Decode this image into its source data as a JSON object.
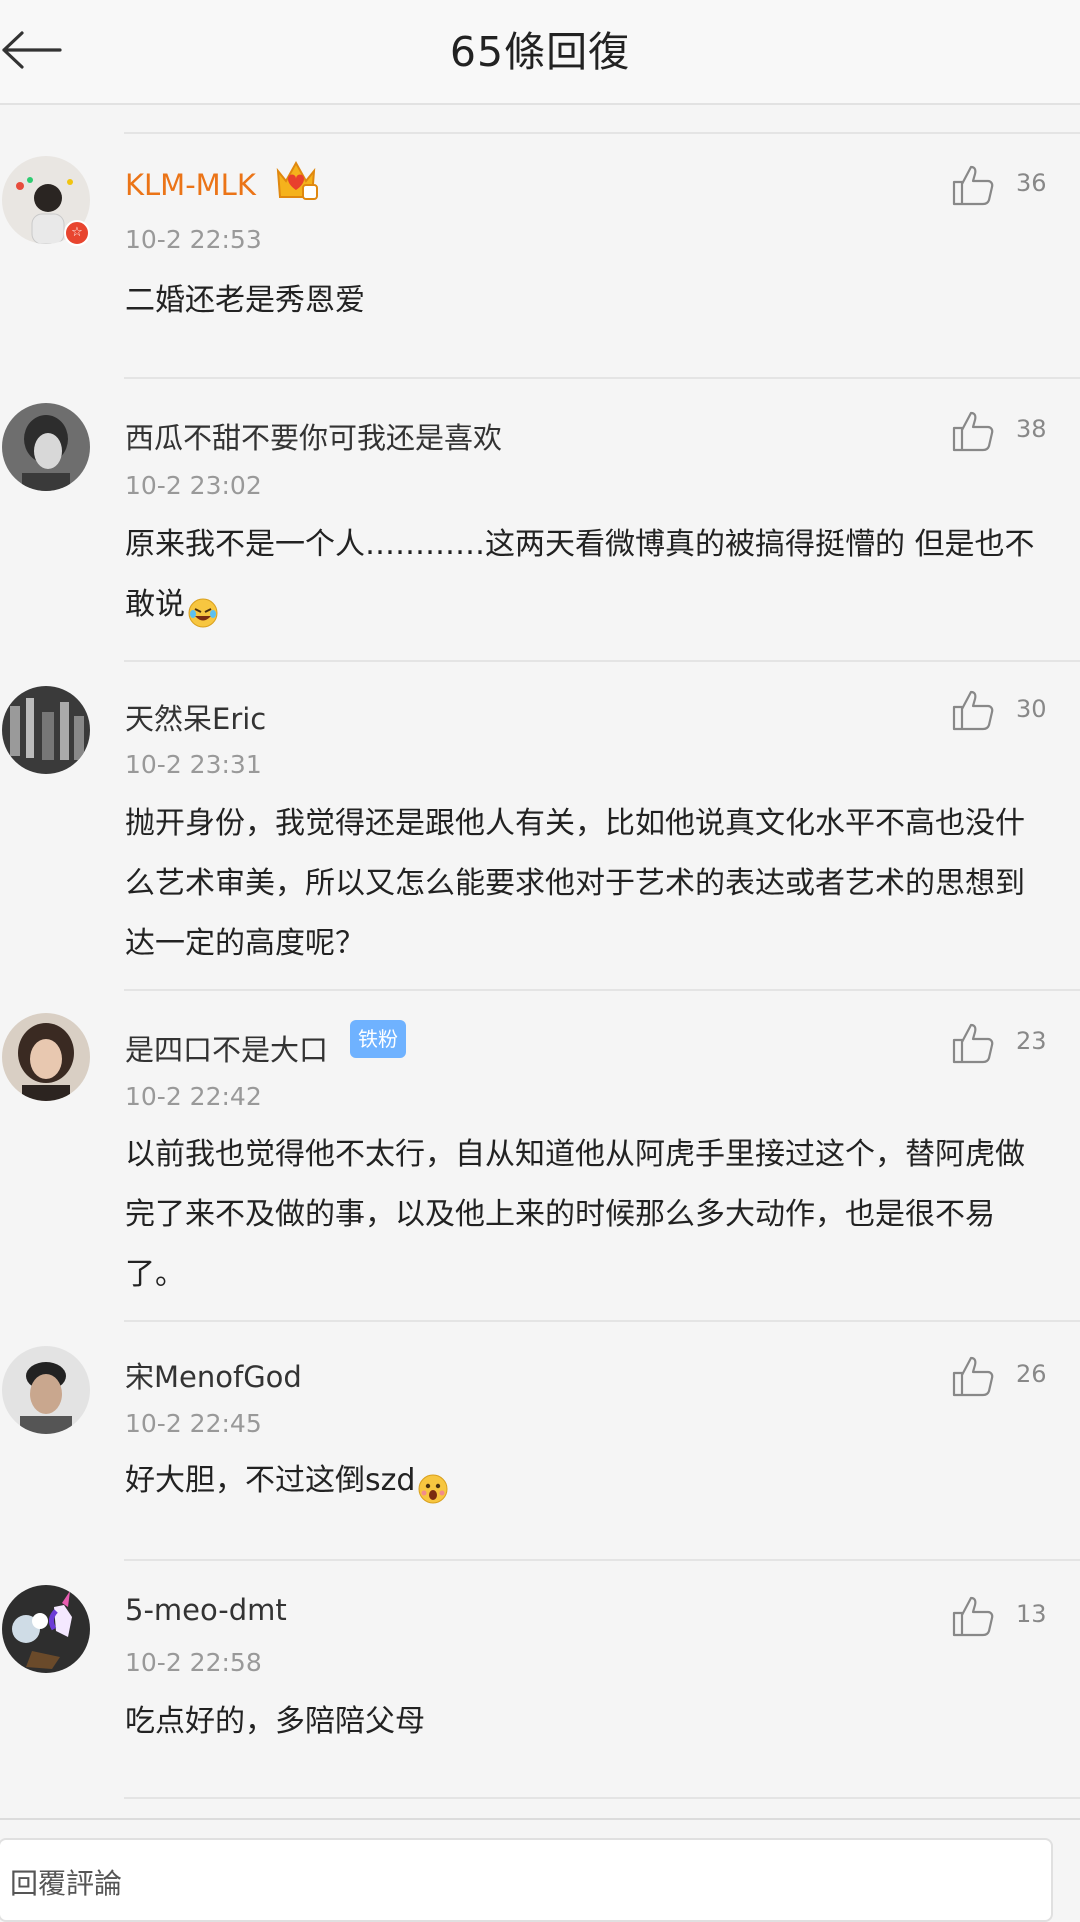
{
  "header": {
    "title": "65條回復",
    "back_icon": "back-arrow-icon"
  },
  "comments": [
    {
      "username": "KLM-MLK",
      "vip": true,
      "time": "10-2 22:53",
      "text": "二婚还老是秀恩爱",
      "likes": "36"
    },
    {
      "username": "西瓜不甜不要你可我还是喜欢",
      "time": "10-2 23:02",
      "text": "原来我不是一个人…………这两天看微博真的被搞得挺懵的 但是也不敢说",
      "likes": "38"
    },
    {
      "username": "天然呆Eric",
      "time": "10-2 23:31",
      "text": "抛开身份，我觉得还是跟他人有关，比如他说真文化水平不高也没什么艺术审美，所以又怎么能要求他对于艺术的表达或者艺术的思想到达一定的高度呢？",
      "likes": "30"
    },
    {
      "username": "是四口不是大口",
      "badge": "铁粉",
      "time": "10-2 22:42",
      "text": "以前我也觉得他不太行，自从知道他从阿虎手里接过这个，替阿虎做完了来不及做的事，以及他上来的时候那么多大动作，也是很不易了。",
      "likes": "23"
    },
    {
      "username": "宋MenofGod",
      "time": "10-2 22:45",
      "text": "好大胆，不过这倒szd",
      "likes": "26"
    },
    {
      "username": "5-meo-dmt",
      "time": "10-2 22:58",
      "text": "吃点好的，多陪陪父母",
      "likes": "13"
    }
  ],
  "reply_bar": {
    "placeholder": "回覆評論"
  },
  "colors": {
    "vip_name": "#eb7417",
    "fan_badge": "#6fb2ff",
    "meta": "#999999"
  }
}
